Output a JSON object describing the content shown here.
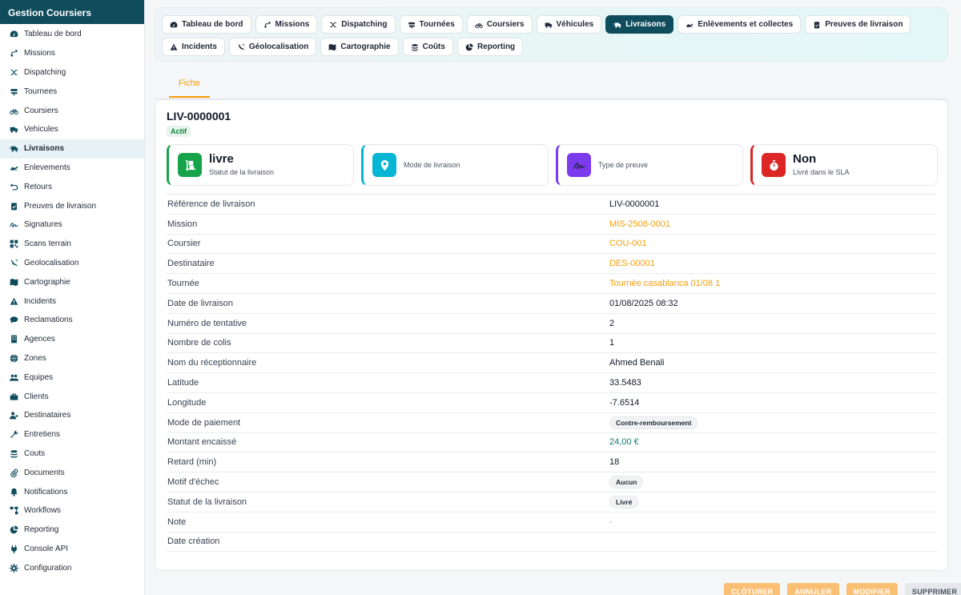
{
  "sidebar": {
    "title": "Gestion Coursiers",
    "items": [
      {
        "label": "Tableau de bord",
        "icon": "dashboard-icon"
      },
      {
        "label": "Missions",
        "icon": "route-icon"
      },
      {
        "label": "Dispatching",
        "icon": "shuffle-icon"
      },
      {
        "label": "Tournees",
        "icon": "signpost-icon"
      },
      {
        "label": "Coursiers",
        "icon": "bicycle-icon"
      },
      {
        "label": "Vehicules",
        "icon": "truck-icon"
      },
      {
        "label": "Livraisons",
        "icon": "truck-fast-icon",
        "active": true
      },
      {
        "label": "Enlevements",
        "icon": "plane-icon"
      },
      {
        "label": "Retours",
        "icon": "return-icon"
      },
      {
        "label": "Preuves de livraison",
        "icon": "clipboard-check-icon"
      },
      {
        "label": "Signatures",
        "icon": "signature-icon"
      },
      {
        "label": "Scans terrain",
        "icon": "qrcode-icon"
      },
      {
        "label": "Geolocalisation",
        "icon": "satellite-icon"
      },
      {
        "label": "Cartographie",
        "icon": "map-icon"
      },
      {
        "label": "Incidents",
        "icon": "warning-icon"
      },
      {
        "label": "Reclamations",
        "icon": "comment-icon"
      },
      {
        "label": "Agences",
        "icon": "building-icon"
      },
      {
        "label": "Zones",
        "icon": "globe-icon"
      },
      {
        "label": "Equipes",
        "icon": "users-icon"
      },
      {
        "label": "Clients",
        "icon": "briefcase-icon"
      },
      {
        "label": "Destinataires",
        "icon": "user-tag-icon"
      },
      {
        "label": "Entretiens",
        "icon": "wrench-icon"
      },
      {
        "label": "Couts",
        "icon": "coins-icon"
      },
      {
        "label": "Documents",
        "icon": "paperclip-icon"
      },
      {
        "label": "Notifications",
        "icon": "bell-icon"
      },
      {
        "label": "Workflows",
        "icon": "workflow-icon"
      },
      {
        "label": "Reporting",
        "icon": "pie-chart-icon"
      },
      {
        "label": "Console API",
        "icon": "plug-icon"
      },
      {
        "label": "Configuration",
        "icon": "gear-icon"
      }
    ]
  },
  "tabs": [
    {
      "label": "Tableau de bord",
      "icon": "dashboard-icon"
    },
    {
      "label": "Missions",
      "icon": "route-icon"
    },
    {
      "label": "Dispatching",
      "icon": "shuffle-icon"
    },
    {
      "label": "Tournées",
      "icon": "signpost-icon"
    },
    {
      "label": "Coursiers",
      "icon": "bicycle-icon"
    },
    {
      "label": "Véhicules",
      "icon": "truck-icon"
    },
    {
      "label": "Livraisons",
      "icon": "truck-fast-icon",
      "active": true
    },
    {
      "label": "Enlèvements et collectes",
      "icon": "plane-icon"
    },
    {
      "label": "Preuves de livraison",
      "icon": "clipboard-check-icon"
    },
    {
      "label": "Incidents",
      "icon": "warning-icon"
    },
    {
      "label": "Géolocalisation",
      "icon": "satellite-icon"
    },
    {
      "label": "Cartographie",
      "icon": "map-icon"
    },
    {
      "label": "Coûts",
      "icon": "coins-icon"
    },
    {
      "label": "Reporting",
      "icon": "pie-chart-icon"
    }
  ],
  "subtab": "Fiche",
  "record": {
    "title": "LIV-0000001",
    "status_badge": "Actif"
  },
  "stats": [
    {
      "value": "livre",
      "label": "Statut de la livraison",
      "icon": "dolly-icon",
      "color": "#16a34a"
    },
    {
      "value": "",
      "label": "Mode de livraison",
      "icon": "location-pin-icon",
      "color": "#06b6d4"
    },
    {
      "value": "",
      "label": "Type de preuve",
      "icon": "signature-icon",
      "color": "#7c3aed"
    },
    {
      "value": "Non",
      "label": "Livré dans le SLA",
      "icon": "stopwatch-icon",
      "color": "#dc2626"
    }
  ],
  "fields": [
    {
      "label": "Référence de livraison",
      "value": "LIV-0000001",
      "kind": "text"
    },
    {
      "label": "Mission",
      "value": "MIS-2508-0001",
      "kind": "link"
    },
    {
      "label": "Coursier",
      "value": "COU-001",
      "kind": "link"
    },
    {
      "label": "Destinataire",
      "value": "DES-00001",
      "kind": "link"
    },
    {
      "label": "Tournée",
      "value": "Tournée casablanca 01/08 1",
      "kind": "link"
    },
    {
      "label": "Date de livraison",
      "value": "01/08/2025 08:32",
      "kind": "text"
    },
    {
      "label": "Numéro de tentative",
      "value": "2",
      "kind": "text"
    },
    {
      "label": "Nombre de colis",
      "value": "1",
      "kind": "text"
    },
    {
      "label": "Nom du réceptionnaire",
      "value": "Ahmed Benali",
      "kind": "text"
    },
    {
      "label": "Latitude",
      "value": "33.5483",
      "kind": "text"
    },
    {
      "label": "Longitude",
      "value": "-7.6514",
      "kind": "text"
    },
    {
      "label": "Mode de paiement",
      "value": "Contre-remboursement",
      "kind": "pill"
    },
    {
      "label": "Montant encaissé",
      "value": "24,00 €",
      "kind": "teal"
    },
    {
      "label": "Retard (min)",
      "value": "18",
      "kind": "text"
    },
    {
      "label": "Motif d'échec",
      "value": "Aucun",
      "kind": "pill"
    },
    {
      "label": "Statut de la livraison",
      "value": "Livré",
      "kind": "pill"
    },
    {
      "label": "Note",
      "value": "-",
      "kind": "muted"
    },
    {
      "label": "Date création",
      "value": "",
      "kind": "text"
    }
  ],
  "actions": [
    {
      "label": "CLÔTURER",
      "style": "orange"
    },
    {
      "label": "ANNULER",
      "style": "orange"
    },
    {
      "label": "MODIFIER",
      "style": "orange"
    },
    {
      "label": "SUPPRIMER",
      "style": "grey"
    }
  ]
}
